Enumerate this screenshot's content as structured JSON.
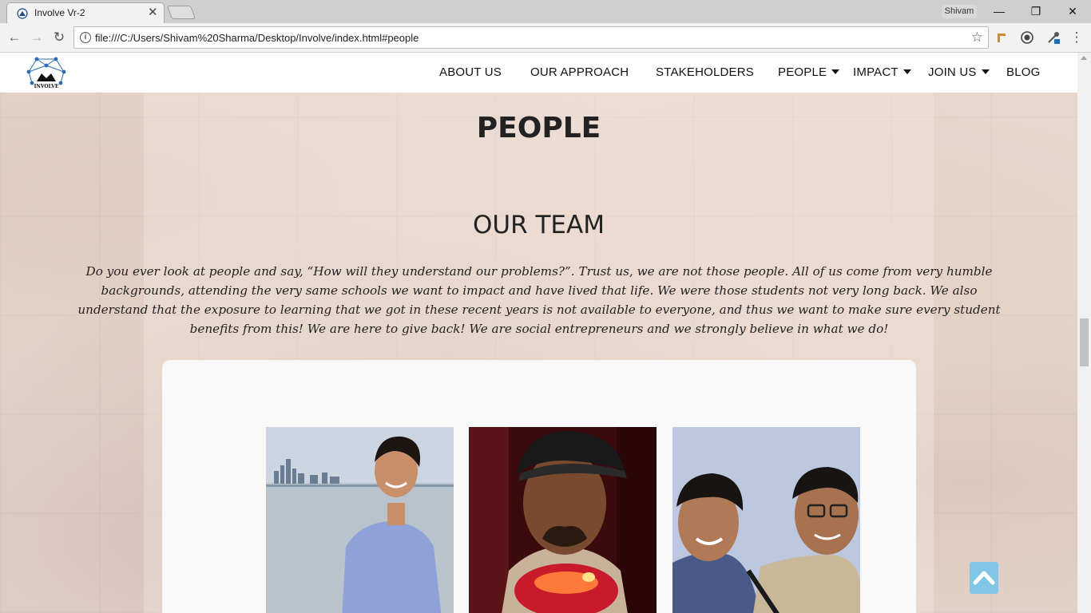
{
  "browser": {
    "tab_title": "Involve Vr-2",
    "tab_close": "✕",
    "profile_name": "Shivam",
    "minimize": "—",
    "maximize": "❐",
    "close": "✕",
    "url": "file:///C:/Users/Shivam%20Sharma/Desktop/Involve/index.html#people",
    "back_glyph": "←",
    "forward_glyph": "→",
    "reload_glyph": "↻",
    "star_glyph": "☆",
    "menu_glyph": "⋮"
  },
  "site": {
    "logo_text": "INVOLVE",
    "nav": {
      "about": "ABOUT US",
      "approach": "OUR APPROACH",
      "stakeholders": "STAKEHOLDERS",
      "people": "PEOPLE",
      "impact": "IMPACT",
      "join": "JOIN US",
      "blog": "BLOG"
    }
  },
  "main": {
    "heading": "PEOPLE",
    "subheading": "OUR TEAM",
    "intro": "Do you ever look at people and say, “How will they understand our problems?”. Trust us, we are not those people. All of us come from very humble backgrounds, attending the very same schools we want to impact and have lived that life. We were those students not very long back. We also understand that the exposure to learning that we got in these recent years is not available to everyone, and thus we want to make sure every student benefits from this! We are here to give back! We are social entrepreneurs and we strongly believe in what we do!"
  },
  "colors": {
    "scroll_top_button": "#7fc6e6",
    "logo_blue": "#2b6cb0"
  },
  "icons": {
    "scroll_top": "chevron-up-icon"
  }
}
